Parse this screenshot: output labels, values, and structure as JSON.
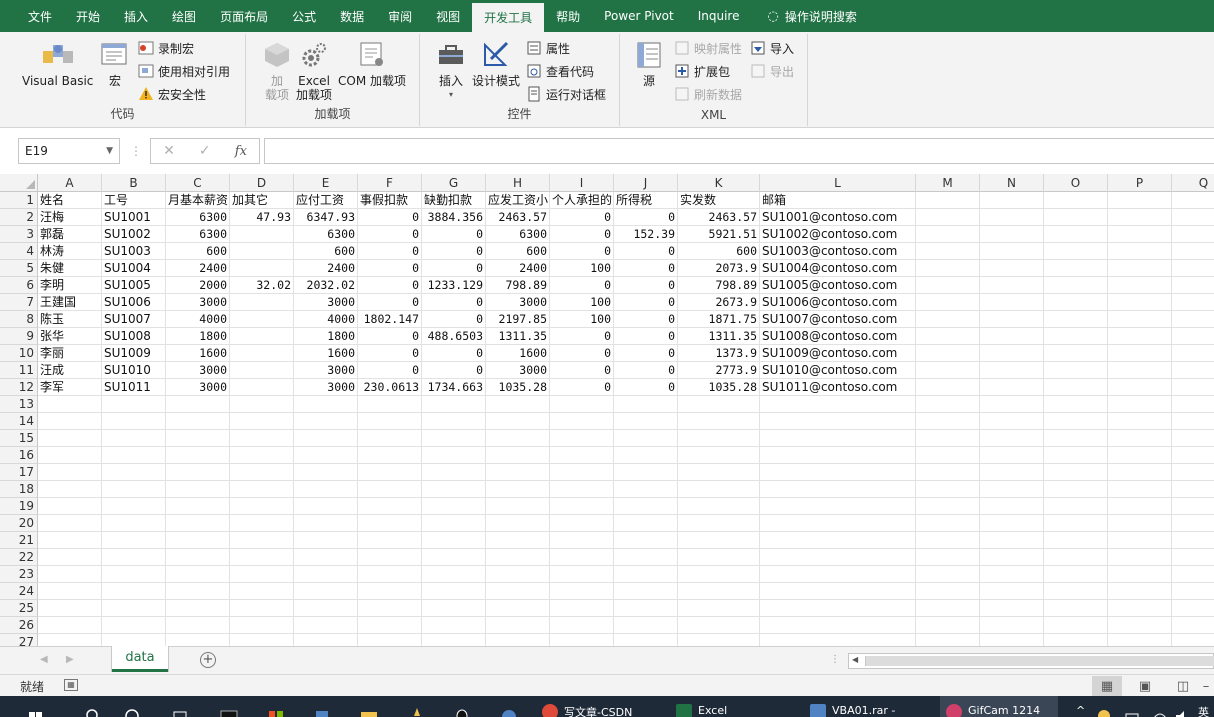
{
  "ribbon_tabs": [
    {
      "label": "文件"
    },
    {
      "label": "开始"
    },
    {
      "label": "插入"
    },
    {
      "label": "绘图"
    },
    {
      "label": "页面布局"
    },
    {
      "label": "公式"
    },
    {
      "label": "数据"
    },
    {
      "label": "审阅"
    },
    {
      "label": "视图"
    },
    {
      "label": "开发工具"
    },
    {
      "label": "帮助"
    },
    {
      "label": "Power Pivot"
    },
    {
      "label": "Inquire"
    },
    {
      "label": "操作说明搜索"
    }
  ],
  "active_tab_index": 9,
  "ribbon": {
    "code": {
      "label": "代码",
      "visual_basic": "Visual Basic",
      "macros": "宏",
      "record_macro": "录制宏",
      "use_relative": "使用相对引用",
      "macro_security": "宏安全性"
    },
    "addins": {
      "label": "加载项",
      "addins_btn_line1": "加",
      "addins_btn_line2": "载项",
      "excel_addins_line1": "Excel",
      "excel_addins_line2": "加载项",
      "com_addins": "COM 加载项"
    },
    "controls": {
      "label": "控件",
      "insert": "插入",
      "design_mode": "设计模式",
      "properties": "属性",
      "view_code": "查看代码",
      "run_dialog": "运行对话框"
    },
    "xml": {
      "label": "XML",
      "source": "源",
      "map_props": "映射属性",
      "expansion": "扩展包",
      "refresh": "刷新数据",
      "import": "导入",
      "export": "导出"
    }
  },
  "formula_bar": {
    "name_box": "E19",
    "fx": "fx",
    "cancel": "✕",
    "enter": "✓"
  },
  "columns": [
    "A",
    "B",
    "C",
    "D",
    "E",
    "F",
    "G",
    "H",
    "I",
    "J",
    "K",
    "L",
    "M",
    "N",
    "O",
    "P",
    "Q"
  ],
  "row_numbers": [
    "1",
    "2",
    "3",
    "4",
    "5",
    "6",
    "7",
    "8",
    "9",
    "10",
    "11",
    "12",
    "13",
    "14",
    "15",
    "16",
    "17",
    "18",
    "19",
    "20",
    "21",
    "22",
    "23",
    "24",
    "25",
    "26",
    "27"
  ],
  "table": {
    "headers": [
      "姓名",
      "工号",
      "月基本薪资",
      "加其它",
      "应付工资",
      "事假扣款",
      "缺勤扣款",
      "应发工资小",
      "个人承担的",
      "所得税",
      "实发数",
      "邮箱"
    ],
    "rows": [
      [
        "汪梅",
        "SU1001",
        "6300",
        "47.93",
        "6347.93",
        "0",
        "3884.356",
        "2463.57",
        "0",
        "0",
        "2463.57",
        "SU1001@contoso.com"
      ],
      [
        "郭磊",
        "SU1002",
        "6300",
        "",
        "6300",
        "0",
        "0",
        "6300",
        "0",
        "152.39",
        "5921.51",
        "SU1002@contoso.com"
      ],
      [
        "林涛",
        "SU1003",
        "600",
        "",
        "600",
        "0",
        "0",
        "600",
        "0",
        "0",
        "600",
        "SU1003@contoso.com"
      ],
      [
        "朱健",
        "SU1004",
        "2400",
        "",
        "2400",
        "0",
        "0",
        "2400",
        "100",
        "0",
        "2073.9",
        "SU1004@contoso.com"
      ],
      [
        "李明",
        "SU1005",
        "2000",
        "32.02",
        "2032.02",
        "0",
        "1233.129",
        "798.89",
        "0",
        "0",
        "798.89",
        "SU1005@contoso.com"
      ],
      [
        "王建国",
        "SU1006",
        "3000",
        "",
        "3000",
        "0",
        "0",
        "3000",
        "100",
        "0",
        "2673.9",
        "SU1006@contoso.com"
      ],
      [
        "陈玉",
        "SU1007",
        "4000",
        "",
        "4000",
        "1802.147",
        "0",
        "2197.85",
        "100",
        "0",
        "1871.75",
        "SU1007@contoso.com"
      ],
      [
        "张华",
        "SU1008",
        "1800",
        "",
        "1800",
        "0",
        "488.6503",
        "1311.35",
        "0",
        "0",
        "1311.35",
        "SU1008@contoso.com"
      ],
      [
        "李丽",
        "SU1009",
        "1600",
        "",
        "1600",
        "0",
        "0",
        "1600",
        "0",
        "0",
        "1373.9",
        "SU1009@contoso.com"
      ],
      [
        "汪成",
        "SU1010",
        "3000",
        "",
        "3000",
        "0",
        "0",
        "3000",
        "0",
        "0",
        "2773.9",
        "SU1010@contoso.com"
      ],
      [
        "李军",
        "SU1011",
        "3000",
        "",
        "3000",
        "230.0613",
        "1734.663",
        "1035.28",
        "0",
        "0",
        "1035.28",
        "SU1011@contoso.com"
      ]
    ]
  },
  "sheet_tabs": [
    {
      "label": "data"
    }
  ],
  "add_sheet": "+",
  "status": {
    "ready": "就绪"
  },
  "taskbar": {
    "items": [
      {
        "label": "写文章-CSDN",
        "color": "#e04a3a"
      },
      {
        "label": "Excel",
        "color": "#217346"
      },
      {
        "label": "VBA01.rar -",
        "color": "#4f83c4"
      },
      {
        "label": "GifCam 1214",
        "color": "#d0406a"
      }
    ],
    "tray_text": "英"
  },
  "colors": {
    "brand": "#217346",
    "ribbon_bg": "#f3f3f3",
    "taskbar": "#1f2a38"
  }
}
